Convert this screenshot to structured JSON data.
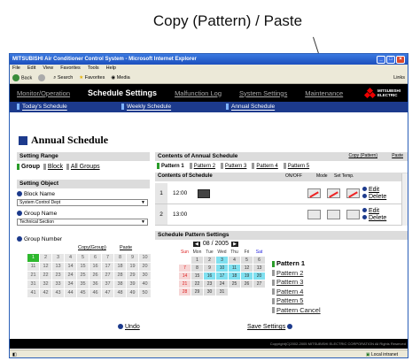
{
  "callouts": {
    "top": "Copy (Pattern) / Paste"
  },
  "window": {
    "title": "MITSUBISHI Air Conditioner Control System - Microsoft Internet Explorer",
    "menu": [
      "File",
      "Edit",
      "View",
      "Favorites",
      "Tools",
      "Help"
    ],
    "toolbar": {
      "back": "Back",
      "search": "Search",
      "favorites": "Favorites",
      "media": "Media",
      "links": "Links"
    }
  },
  "nav": {
    "items": [
      "Monitor/Operation",
      "Schedule Settings",
      "Malfunction Log",
      "System Settings",
      "Maintenance"
    ],
    "active_index": 1,
    "logo": [
      "MITSUBISHI",
      "ELECTRIC"
    ],
    "sub": [
      "Today's Schedule",
      "Weekly Schedule",
      "Annual Schedule"
    ]
  },
  "page_title": "Annual Schedule",
  "left": {
    "setting_range": "Setting Range",
    "range_options": [
      "Group",
      "Block",
      "All Groups"
    ],
    "setting_object": "Setting Object",
    "block_name_label": "Block Name",
    "block_name_value": "System Control Dept",
    "group_name_label": "Group Name",
    "group_name_value": "Technical Section",
    "group_number_label": "Group Number",
    "copy_group": "Copy(Group)",
    "paste": "Paste",
    "numbers": [
      "1",
      "2",
      "3",
      "4",
      "5",
      "6",
      "7",
      "8",
      "9",
      "10",
      "11",
      "12",
      "13",
      "14",
      "15",
      "16",
      "17",
      "18",
      "19",
      "20",
      "21",
      "22",
      "23",
      "24",
      "25",
      "26",
      "27",
      "28",
      "29",
      "30",
      "31",
      "32",
      "33",
      "34",
      "35",
      "36",
      "37",
      "38",
      "39",
      "40",
      "41",
      "42",
      "43",
      "44",
      "45",
      "46",
      "47",
      "48",
      "49",
      "50"
    ],
    "selected_number": "1",
    "undo": "Undo"
  },
  "contents": {
    "title": "Contents of Annual Schedule",
    "copy_pattern": "Copy (Pattern)",
    "paste": "Paste",
    "patterns": [
      "Pattern 1",
      "Pattern 2",
      "Pattern 3",
      "Pattern 4",
      "Pattern 5"
    ],
    "schedule_title": "Contents of Schedule",
    "cols": [
      "ON/OFF",
      "Mode",
      "Set Temp."
    ],
    "rows": [
      {
        "idx": "1",
        "time": "12:00",
        "edit": "Edit",
        "delete": "Delete"
      },
      {
        "idx": "2",
        "time": "13:00",
        "edit": "Edit",
        "delete": "Delete"
      }
    ]
  },
  "pattern_settings": {
    "title": "Schedule Pattern Settings",
    "month": "08 / 2005",
    "days": [
      "Sun",
      "Mon",
      "Tue",
      "Wed",
      "Thu",
      "Fri",
      "Sat"
    ],
    "weeks": [
      [
        "",
        "1",
        "2",
        "3",
        "4",
        "5",
        "6"
      ],
      [
        "7",
        "8",
        "9",
        "10",
        "11",
        "12",
        "13"
      ],
      [
        "14",
        "15",
        "16",
        "17",
        "18",
        "19",
        "20"
      ],
      [
        "21",
        "22",
        "23",
        "24",
        "25",
        "26",
        "27"
      ],
      [
        "28",
        "29",
        "30",
        "31",
        "",
        "",
        ""
      ]
    ],
    "pattern_links": [
      "Pattern 1",
      "Pattern 2",
      "Pattern 3",
      "Pattern 4",
      "Pattern 5",
      "Pattern Cancel"
    ],
    "save": "Save Settings"
  },
  "footer": "Copyright(C)2002-2005 MITSUBISHI ELECTRIC CORPORATION All Rights Reserved",
  "status": {
    "zone": "Local intranet"
  }
}
